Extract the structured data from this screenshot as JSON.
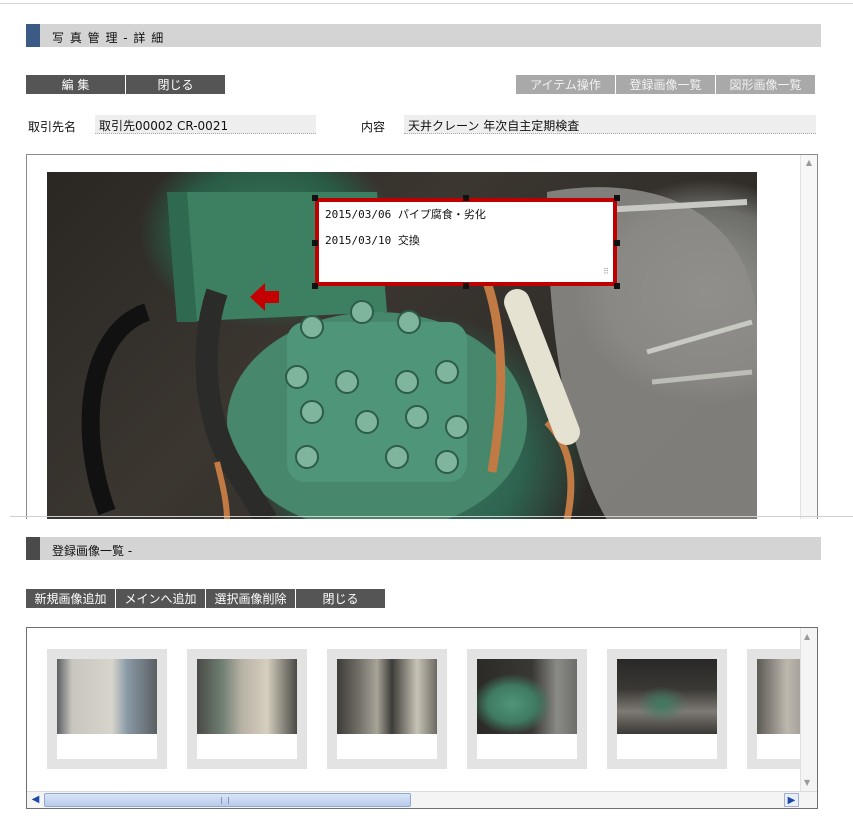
{
  "photo_header": {
    "title": "写 真 管 理 - 詳 細",
    "accent": "#3b5a86"
  },
  "toolbar": {
    "edit_label": "編 集",
    "close_label": "閉じる",
    "item_ops_label": "アイテム操作",
    "registered_list_label": "登録画像一覧",
    "shape_list_label": "図形画像一覧"
  },
  "fields": {
    "client_label": "取引先名",
    "client_value": "取引先00002 CR-0021",
    "content_label": "内容",
    "content_value": "天井クレーン 年次自主定期検査"
  },
  "memo": {
    "line1": "2015/03/06 パイプ腐食・劣化",
    "line2": "2015/03/10 交換",
    "border_color": "#c00000"
  },
  "registered_header": {
    "title": "登録画像一覧 -",
    "accent": "#4a4a4a"
  },
  "list_toolbar": {
    "new_image_label": "新規画像追加",
    "add_to_main_label": "メインへ追加",
    "delete_selected_label": "選択画像削除",
    "close_label": "閉じる"
  },
  "thumbnails": [
    {
      "name": "thumb-1",
      "colors": [
        "#c9c6bf",
        "#8a9aa6",
        "#5a5f62"
      ]
    },
    {
      "name": "thumb-2",
      "colors": [
        "#b8b2a5",
        "#6f7f72",
        "#4a4a46"
      ]
    },
    {
      "name": "thumb-3",
      "colors": [
        "#a7a397",
        "#6d6a63",
        "#3e3c38"
      ]
    },
    {
      "name": "thumb-4",
      "colors": [
        "#3f7b62",
        "#2b2a27",
        "#8a8a86"
      ]
    },
    {
      "name": "thumb-5",
      "colors": [
        "#3a3835",
        "#3e7b61",
        "#7e7b75"
      ]
    },
    {
      "name": "thumb-6",
      "colors": [
        "#bdb8ae",
        "#5d5a55",
        "#8a8680"
      ]
    }
  ]
}
